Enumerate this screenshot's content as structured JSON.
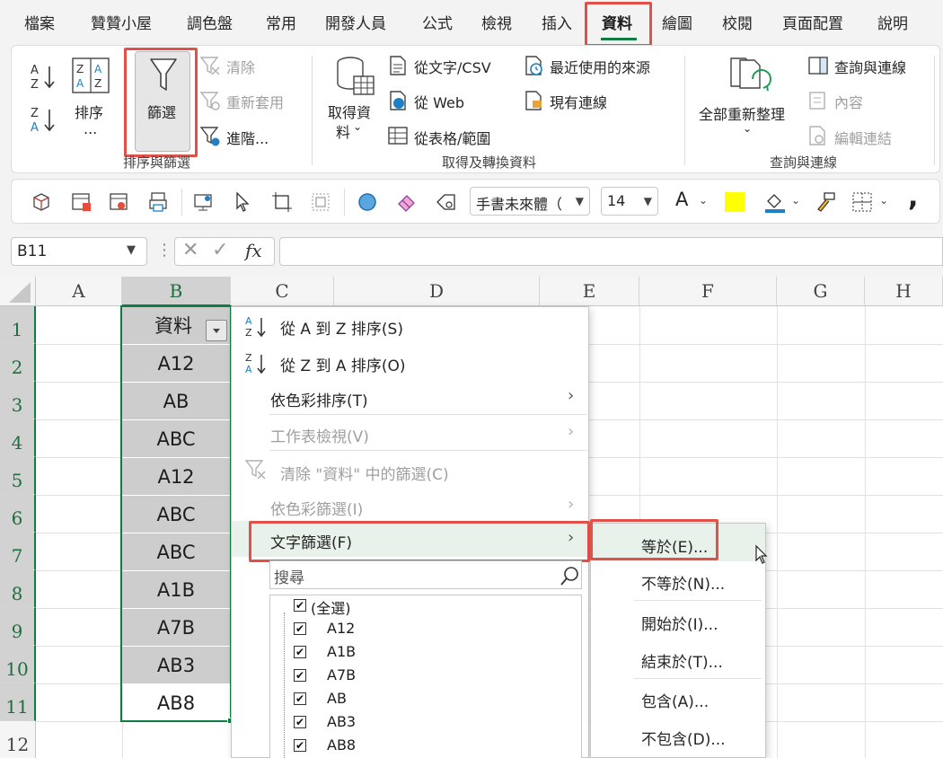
{
  "tabs": [
    {
      "label": "檔案"
    },
    {
      "label": "贊贊小屋"
    },
    {
      "label": "調色盤"
    },
    {
      "label": "常用"
    },
    {
      "label": "開發人員"
    },
    {
      "label": "公式"
    },
    {
      "label": "檢視"
    },
    {
      "label": "插入"
    },
    {
      "label": "資料"
    },
    {
      "label": "繪圖"
    },
    {
      "label": "校閱"
    },
    {
      "label": "頁面配置"
    },
    {
      "label": "說明"
    }
  ],
  "active_tab": "資料",
  "ribbon": {
    "sort_filter": {
      "sort_label": "排序",
      "sort_more": "...",
      "filter_label": "篩選",
      "clear": "清除",
      "reapply": "重新套用",
      "advanced": "進階...",
      "group": "排序與篩選"
    },
    "get_transform": {
      "get_data_line1": "取得資",
      "get_data_line2": "料",
      "from_text_csv": "從文字/CSV",
      "from_web": "從 Web",
      "from_table": "從表格/範圍",
      "recent_sources": "最近使用的來源",
      "existing_connections": "現有連線",
      "group": "取得及轉換資料"
    },
    "queries": {
      "refresh_all": "全部重新整理",
      "queries_connections": "查詢與連線",
      "properties": "內容",
      "edit_links": "編輯連結",
      "group": "查詢與連線"
    }
  },
  "quickbar": {
    "font_name": "手書未來體（",
    "font_size": "14",
    "font_color_letter": "A",
    "highlight_color": "#ffff00",
    "comma": ","
  },
  "formula_bar": {
    "name_box": "B11",
    "fx": "fx",
    "formula": ""
  },
  "columns": [
    "A",
    "B",
    "C",
    "D",
    "E",
    "F",
    "G",
    "H"
  ],
  "rows": [
    "1",
    "2",
    "3",
    "4",
    "5",
    "6",
    "7",
    "8",
    "9",
    "10",
    "11",
    "12"
  ],
  "column_b": {
    "header": "資料",
    "values": [
      "A12",
      "AB",
      "ABC",
      "A12",
      "ABC",
      "ABC",
      "A1B",
      "A7B",
      "AB3",
      "AB8"
    ]
  },
  "filter_menu": {
    "sort_az": "從 A 到 Z 排序(S)",
    "sort_za": "從 Z 到 A 排序(O)",
    "sort_by_color": "依色彩排序(T)",
    "sheet_view": "工作表檢視(V)",
    "clear_filter": "清除 \"資料\" 中的篩選(C)",
    "filter_by_color": "依色彩篩選(I)",
    "text_filters": "文字篩選(F)",
    "search_placeholder": "搜尋",
    "select_all": "(全選)",
    "items": [
      "A12",
      "A1B",
      "A7B",
      "AB",
      "AB3",
      "AB8"
    ]
  },
  "text_filter_submenu": {
    "equals": "等於(E)...",
    "not_equals": "不等於(N)...",
    "begins_with": "開始於(I)...",
    "ends_with": "結束於(T)...",
    "contains": "包含(A)...",
    "not_contains": "不包含(D)..."
  },
  "colors": {
    "accent_green": "#107c41",
    "highlight_red": "#e2504a",
    "selection_gray": "#cdcdcd",
    "hover_green": "#e8f1ea"
  }
}
